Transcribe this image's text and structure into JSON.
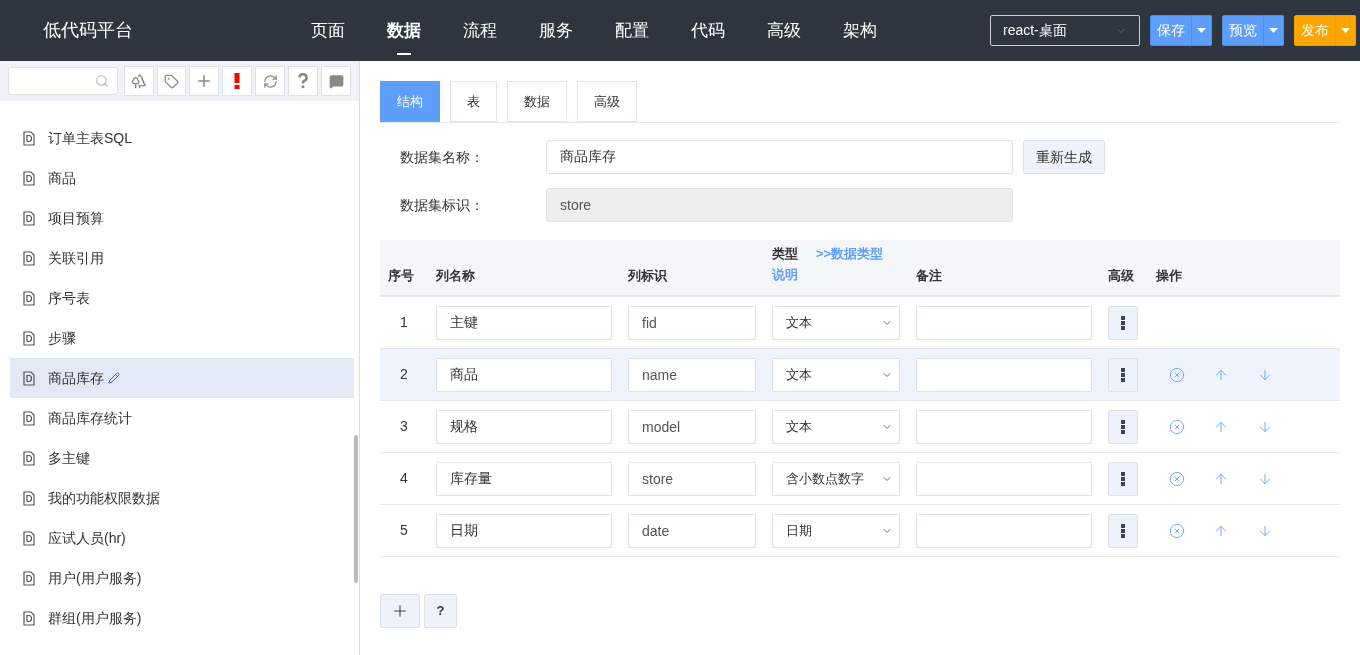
{
  "header": {
    "title": "低代码平台",
    "nav": [
      {
        "label": "页面",
        "selected": false
      },
      {
        "label": "数据",
        "selected": true
      },
      {
        "label": "流程",
        "selected": false
      },
      {
        "label": "服务",
        "selected": false
      },
      {
        "label": "配置",
        "selected": false
      },
      {
        "label": "代码",
        "selected": false
      },
      {
        "label": "高级",
        "selected": false
      },
      {
        "label": "架构",
        "selected": false
      }
    ],
    "project": "react-桌面",
    "buttons": [
      {
        "label": "保存",
        "kind": "primary"
      },
      {
        "label": "预览",
        "kind": "primary"
      },
      {
        "label": "发布",
        "kind": "warning"
      }
    ]
  },
  "sidebar": {
    "toolbar": [
      {
        "kind": "tree"
      },
      {
        "kind": "tag"
      },
      {
        "kind": "plus"
      },
      {
        "kind": "alert"
      },
      {
        "kind": "refresh"
      },
      {
        "kind": "help"
      },
      {
        "kind": "chat"
      }
    ],
    "items": [
      {
        "label": "订单主表SQL",
        "selected": false
      },
      {
        "label": "商品",
        "selected": false
      },
      {
        "label": "项目预算",
        "selected": false
      },
      {
        "label": "关联引用",
        "selected": false
      },
      {
        "label": "序号表",
        "selected": false
      },
      {
        "label": "步骤",
        "selected": false
      },
      {
        "label": "商品库存",
        "selected": true
      },
      {
        "label": "商品库存统计",
        "selected": false
      },
      {
        "label": "多主键",
        "selected": false
      },
      {
        "label": "我的功能权限数据",
        "selected": false
      },
      {
        "label": "应试人员(hr)",
        "selected": false
      },
      {
        "label": "用户(用户服务)",
        "selected": false
      },
      {
        "label": "群组(用户服务)",
        "selected": false
      }
    ]
  },
  "tabs": [
    {
      "label": "结构",
      "selected": true
    },
    {
      "label": "表",
      "selected": false
    },
    {
      "label": "数据",
      "selected": false
    },
    {
      "label": "高级",
      "selected": false
    }
  ],
  "form": {
    "name_label": "数据集名称：",
    "name_value": "商品库存",
    "regenerate": "重新生成",
    "id_label": "数据集标识：",
    "id_value": "store"
  },
  "table": {
    "columns": {
      "index": "序号",
      "name": "列名称",
      "key": "列标识",
      "type": "类型",
      "type_link": ">>数据类型",
      "type_note": "说明",
      "remark": "备注",
      "advanced": "高级",
      "actions": "操作"
    },
    "rows": [
      {
        "index": "1",
        "name": "主键",
        "key": "fid",
        "type": "文本",
        "selected": false,
        "removable": false
      },
      {
        "index": "2",
        "name": "商品",
        "key": "name",
        "type": "文本",
        "selected": true,
        "removable": true
      },
      {
        "index": "3",
        "name": "规格",
        "key": "model",
        "type": "文本",
        "selected": false,
        "removable": true
      },
      {
        "index": "4",
        "name": "库存量",
        "key": "store",
        "type": "含小数点数字",
        "selected": false,
        "removable": true
      },
      {
        "index": "5",
        "name": "日期",
        "key": "date",
        "type": "日期",
        "selected": false,
        "removable": true
      }
    ]
  },
  "footer_buttons": [
    {
      "kind": "add"
    },
    {
      "kind": "help",
      "label": "?"
    }
  ]
}
